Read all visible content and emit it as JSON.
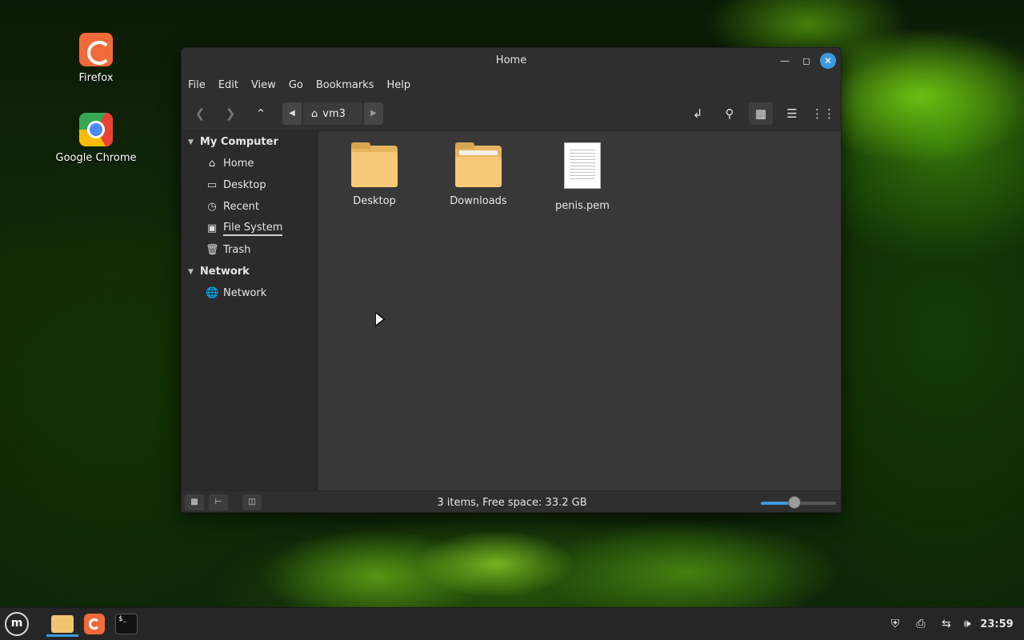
{
  "desktop": {
    "icons": [
      {
        "label": "Firefox",
        "icon": "firefox-icon"
      },
      {
        "label": "Google Chrome",
        "icon": "chrome-icon"
      }
    ]
  },
  "window": {
    "title": "Home",
    "menu": [
      "File",
      "Edit",
      "View",
      "Go",
      "Bookmarks",
      "Help"
    ],
    "path_crumb": "vm3",
    "sidebar": {
      "sections": [
        {
          "label": "My Computer",
          "items": [
            "Home",
            "Desktop",
            "Recent",
            "File System",
            "Trash"
          ]
        },
        {
          "label": "Network",
          "items": [
            "Network"
          ]
        }
      ]
    },
    "files": [
      {
        "name": "Desktop",
        "type": "folder"
      },
      {
        "name": "Downloads",
        "type": "folder"
      },
      {
        "name": "penis.pem",
        "type": "document"
      }
    ],
    "status": "3 items, Free space: 33.2 GB",
    "zoom_level_fraction": 0.45,
    "accent_color": "#3b9ae0"
  },
  "taskbar": {
    "apps": [
      "menu-icon",
      "files-icon",
      "firefox-icon",
      "terminal-icon"
    ],
    "tray": [
      "shield-icon",
      "printer-icon",
      "network-icon",
      "volume-icon"
    ],
    "clock": "23:59"
  }
}
